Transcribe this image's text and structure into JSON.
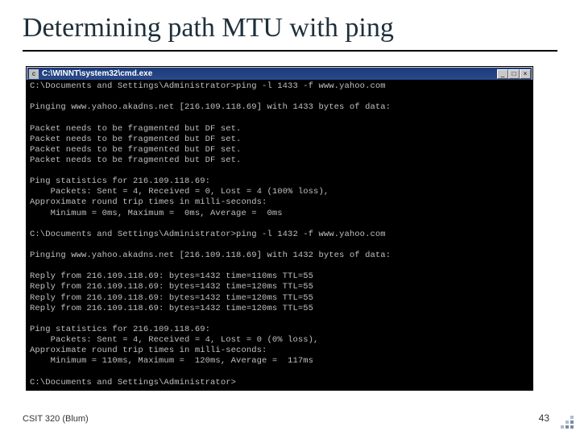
{
  "slide": {
    "title": "Determining path MTU with ping",
    "footer_left": "CSIT 320 (Blum)",
    "page_number": "43"
  },
  "cmd": {
    "title": "C:\\WINNT\\system32\\cmd.exe",
    "prompt": "C:\\Documents and Settings\\Administrator>",
    "command1": "ping -l 1433 -f www.yahoo.com",
    "pinging1": "Pinging www.yahoo.akadns.net [216.109.118.69] with 1433 bytes of data:",
    "frag_line": "Packet needs to be fragmented but DF set.",
    "stats_header1": "Ping statistics for 216.109.118.69:",
    "stats_packets1": "    Packets: Sent = 4, Received = 0, Lost = 4 (100% loss),",
    "stats_rtt_hdr1": "Approximate round trip times in milli-seconds:",
    "stats_rtt1": "    Minimum = 0ms, Maximum =  0ms, Average =  0ms",
    "command2": "ping -l 1432 -f www.yahoo.com",
    "pinging2": "Pinging www.yahoo.akadns.net [216.109.118.69] with 1432 bytes of data:",
    "reply1": "Reply from 216.109.118.69: bytes=1432 time=110ms TTL=55",
    "reply2": "Reply from 216.109.118.69: bytes=1432 time=120ms TTL=55",
    "reply3": "Reply from 216.109.118.69: bytes=1432 time=120ms TTL=55",
    "reply4": "Reply from 216.109.118.69: bytes=1432 time=120ms TTL=55",
    "stats_header2": "Ping statistics for 216.109.118.69:",
    "stats_packets2": "    Packets: Sent = 4, Received = 4, Lost = 0 (0% loss),",
    "stats_rtt_hdr2": "Approximate round trip times in milli-seconds:",
    "stats_rtt2": "    Minimum = 110ms, Maximum =  120ms, Average =  117ms"
  },
  "winbtn": {
    "min": "_",
    "max": "□",
    "close": "×"
  }
}
